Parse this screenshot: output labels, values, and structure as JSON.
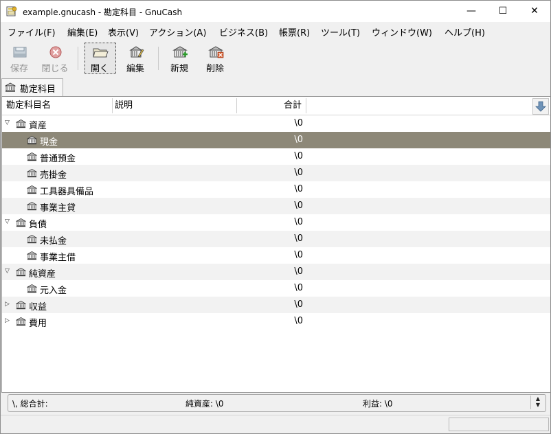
{
  "window": {
    "title": "example.gnucash - 勘定科目 - GnuCash",
    "min_glyph": "—",
    "max_glyph": "☐",
    "close_glyph": "✕"
  },
  "menu": [
    "ファイル(F)",
    "編集(E)",
    "表示(V)",
    "アクション(A)",
    "ビジネス(B)",
    "帳票(R)",
    "ツール(T)",
    "ウィンドウ(W)",
    "ヘルプ(H)"
  ],
  "toolbar": {
    "save": "保存",
    "close": "閉じる",
    "open": "開く",
    "edit": "編集",
    "new": "新規",
    "delete": "削除"
  },
  "tab": {
    "label": "勘定科目"
  },
  "columns": {
    "name": "勘定科目名",
    "description": "説明",
    "total": "合計"
  },
  "accounts": [
    {
      "name": "資産",
      "total": "\\0",
      "level": 0,
      "expander": "expanded"
    },
    {
      "name": "現金",
      "total": "\\0",
      "level": 1,
      "selected": true
    },
    {
      "name": "普通預金",
      "total": "\\0",
      "level": 1
    },
    {
      "name": "売掛金",
      "total": "\\0",
      "level": 1
    },
    {
      "name": "工具器具備品",
      "total": "\\0",
      "level": 1
    },
    {
      "name": "事業主貸",
      "total": "\\0",
      "level": 1
    },
    {
      "name": "負債",
      "total": "\\0",
      "level": 0,
      "expander": "expanded"
    },
    {
      "name": "未払金",
      "total": "\\0",
      "level": 1
    },
    {
      "name": "事業主借",
      "total": "\\0",
      "level": 1
    },
    {
      "name": "純資産",
      "total": "\\0",
      "level": 0,
      "expander": "expanded"
    },
    {
      "name": "元入金",
      "total": "\\0",
      "level": 1
    },
    {
      "name": "収益",
      "total": "\\0",
      "level": 0,
      "expander": "collapsed"
    },
    {
      "name": "費用",
      "total": "\\0",
      "level": 0,
      "expander": "collapsed"
    }
  ],
  "summary": {
    "grand_total": "\\, 総合計:",
    "net_assets": "純資産: \\0",
    "profit": "利益: \\0"
  },
  "colors": {
    "selected_row": "#8d8878",
    "alt_row": "#f2f2f2"
  }
}
